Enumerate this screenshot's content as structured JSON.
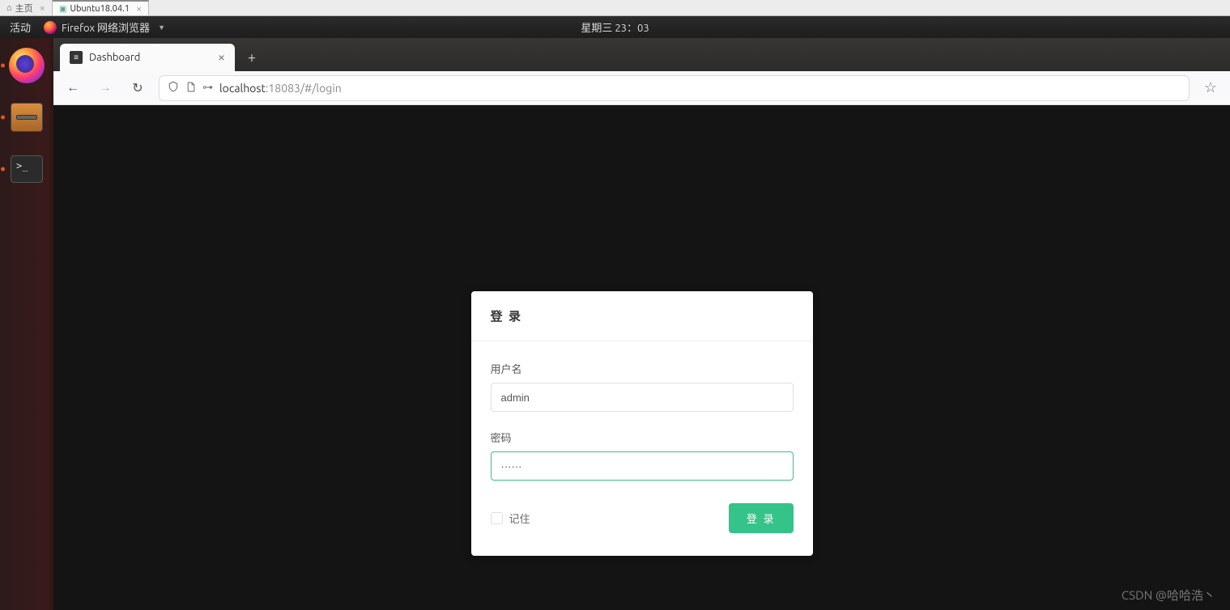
{
  "vm_host": {
    "home_tab": "主页",
    "guest_tab": "Ubuntu18.04.1"
  },
  "gnome": {
    "activities": "活动",
    "app_name": "Firefox 网络浏览器",
    "clock": "星期三 23：03"
  },
  "dock": {
    "firefox": "firefox",
    "files": "files",
    "terminal": "terminal"
  },
  "browser": {
    "tab_title": "Dashboard",
    "url_host": "localhost",
    "url_path": ":18083/#/login"
  },
  "login": {
    "title": "登 录",
    "username_label": "用户名",
    "username_value": "admin",
    "password_label": "密码",
    "password_value": "······",
    "remember_label": "记住",
    "submit_label": "登 录"
  },
  "watermark": "CSDN @哈哈浩丶"
}
